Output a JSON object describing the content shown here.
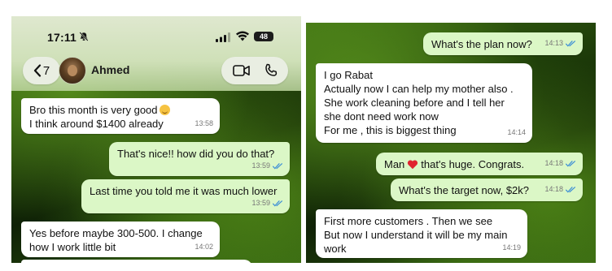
{
  "left": {
    "status": {
      "time": "17:11",
      "battery": "48"
    },
    "header": {
      "back_count": "7",
      "contact_name": "Ahmed"
    },
    "messages": [
      {
        "dir": "in",
        "lines": [
          "Bro this month is very good",
          "I think around $1400 already"
        ],
        "time": "13:58"
      },
      {
        "dir": "out",
        "lines": [
          "That's nice!! how did you do that?"
        ],
        "time": "13:59"
      },
      {
        "dir": "out",
        "lines": [
          "Last time you told me it was much lower"
        ],
        "time": "13:59"
      },
      {
        "dir": "in",
        "lines": [
          "Yes before maybe 300-500. I change",
          "how I work little bit"
        ],
        "time": "14:02"
      }
    ]
  },
  "right": {
    "messages": [
      {
        "dir": "out",
        "lines": [
          "What's the plan now?"
        ],
        "time": "14:13"
      },
      {
        "dir": "in",
        "lines": [
          "I go Rabat",
          "Actually now I can help my mother also .",
          "She work cleaning before and I tell her",
          "she dont need work now",
          "For me , this is biggest thing"
        ],
        "time": "14:14"
      },
      {
        "dir": "out",
        "before": "Man",
        "after": "that's huge. Congrats.",
        "time": "14:18"
      },
      {
        "dir": "out",
        "lines": [
          "What's the target now, $2k?"
        ],
        "time": "14:18"
      },
      {
        "dir": "in",
        "lines": [
          "First more customers . Then we see",
          "But now I understand it will be my main",
          "work"
        ],
        "time": "14:19"
      }
    ]
  },
  "colors": {
    "bubble_out": "#dbf7c6",
    "bubble_in": "#ffffff",
    "read_ticks": "#3d8fd6",
    "heart": "#e0242f"
  },
  "icons": [
    "muted-bell-icon",
    "signal-icon",
    "wifi-icon",
    "battery-icon",
    "chevron-left-icon",
    "video-call-icon",
    "voice-call-icon",
    "read-ticks-icon",
    "heart-emoji-icon",
    "grin-sweat-emoji-icon"
  ]
}
